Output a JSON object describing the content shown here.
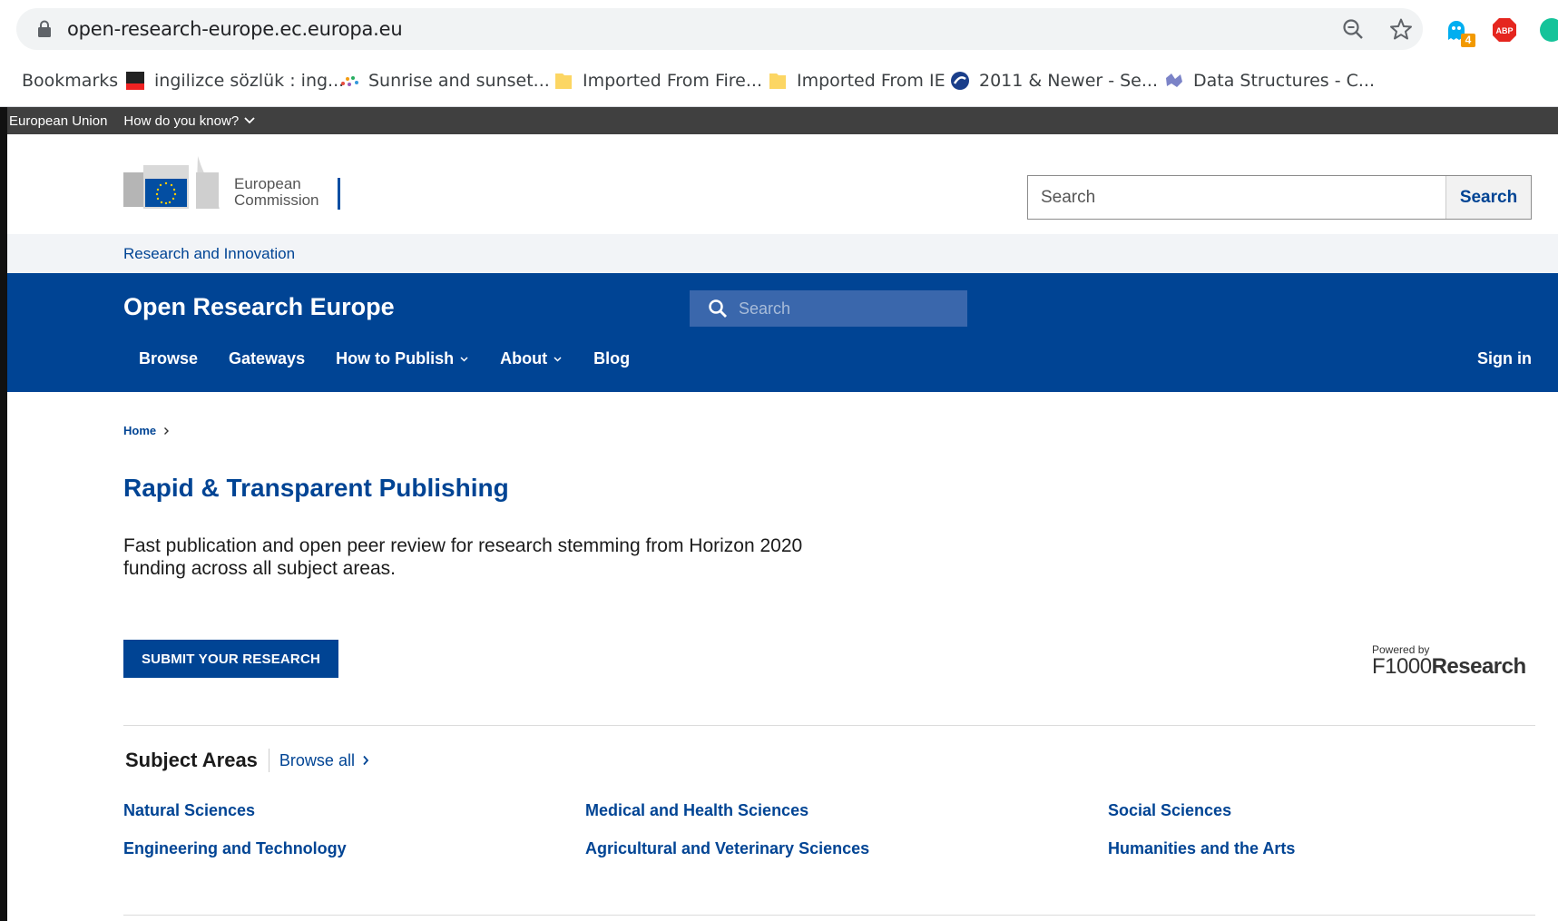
{
  "browser": {
    "url": "open-research-europe.ec.europa.eu",
    "extension_badge": "4",
    "bookmarks": [
      {
        "label": "Bookmarks"
      },
      {
        "label": "ingilizce sözlük : ing..."
      },
      {
        "label": "Sunrise and sunset..."
      },
      {
        "label": "Imported From Fire..."
      },
      {
        "label": "Imported From IE"
      },
      {
        "label": "2011 & Newer - Se..."
      },
      {
        "label": "Data Structures - C..."
      }
    ]
  },
  "eu_bar": {
    "label": "European Union",
    "how": "How do you know?"
  },
  "ec_header": {
    "logo_line1": "European",
    "logo_line2": "Commission",
    "search_placeholder": "Search",
    "search_button": "Search"
  },
  "ri": {
    "label": "Research and Innovation"
  },
  "ore": {
    "title": "Open Research Europe",
    "search_placeholder": "Search",
    "nav": {
      "browse": "Browse",
      "gateways": "Gateways",
      "how_to_publish": "How to Publish",
      "about": "About",
      "blog": "Blog"
    },
    "sign_in": "Sign in"
  },
  "breadcrumb": {
    "home": "Home"
  },
  "hero": {
    "title": "Rapid & Transparent Publishing",
    "text": "Fast publication and open peer review for research stemming from Horizon 2020 funding across all subject areas.",
    "submit": "SUBMIT YOUR RESEARCH",
    "powered_by": "Powered by",
    "brand_a": "F1000",
    "brand_b": "Research"
  },
  "subjects": {
    "title": "Subject Areas",
    "browse_all": "Browse all",
    "items": [
      "Natural Sciences",
      "Medical and Health Sciences",
      "Social Sciences",
      "Engineering and Technology",
      "Agricultural and Veterinary Sciences",
      "Humanities and the Arts"
    ]
  },
  "colors": {
    "brand_blue": "#004494",
    "eu_bar": "#404040",
    "ri_bar": "#f2f4f7"
  }
}
